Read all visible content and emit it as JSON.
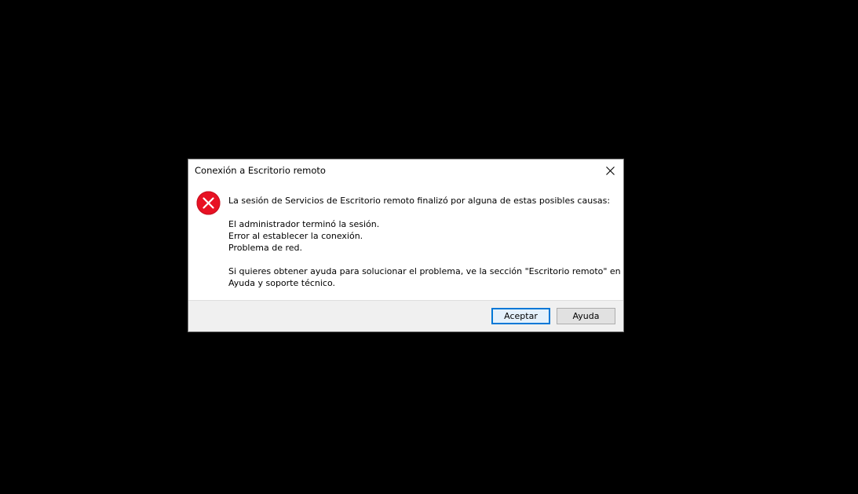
{
  "dialog": {
    "title": "Conexión a Escritorio remoto",
    "close_label": "×"
  },
  "message": {
    "intro": "La sesión de Servicios de Escritorio remoto finalizó por alguna de estas posibles causas:",
    "causes": [
      "El administrador terminó la sesión.",
      "Error al establecer la conexión.",
      "Problema de red."
    ],
    "help_line1": "Si quieres obtener ayuda para solucionar el problema, ve la sección \"Escritorio remoto\" en",
    "help_line2": "Ayuda y soporte técnico."
  },
  "buttons": {
    "accept_label": "Aceptar",
    "help_label": "Ayuda"
  },
  "icons": {
    "error": "error-circle-x-icon",
    "close": "close-icon"
  },
  "colors": {
    "background": "#000000",
    "error_red": "#e81123",
    "accent": "#0078d7"
  }
}
